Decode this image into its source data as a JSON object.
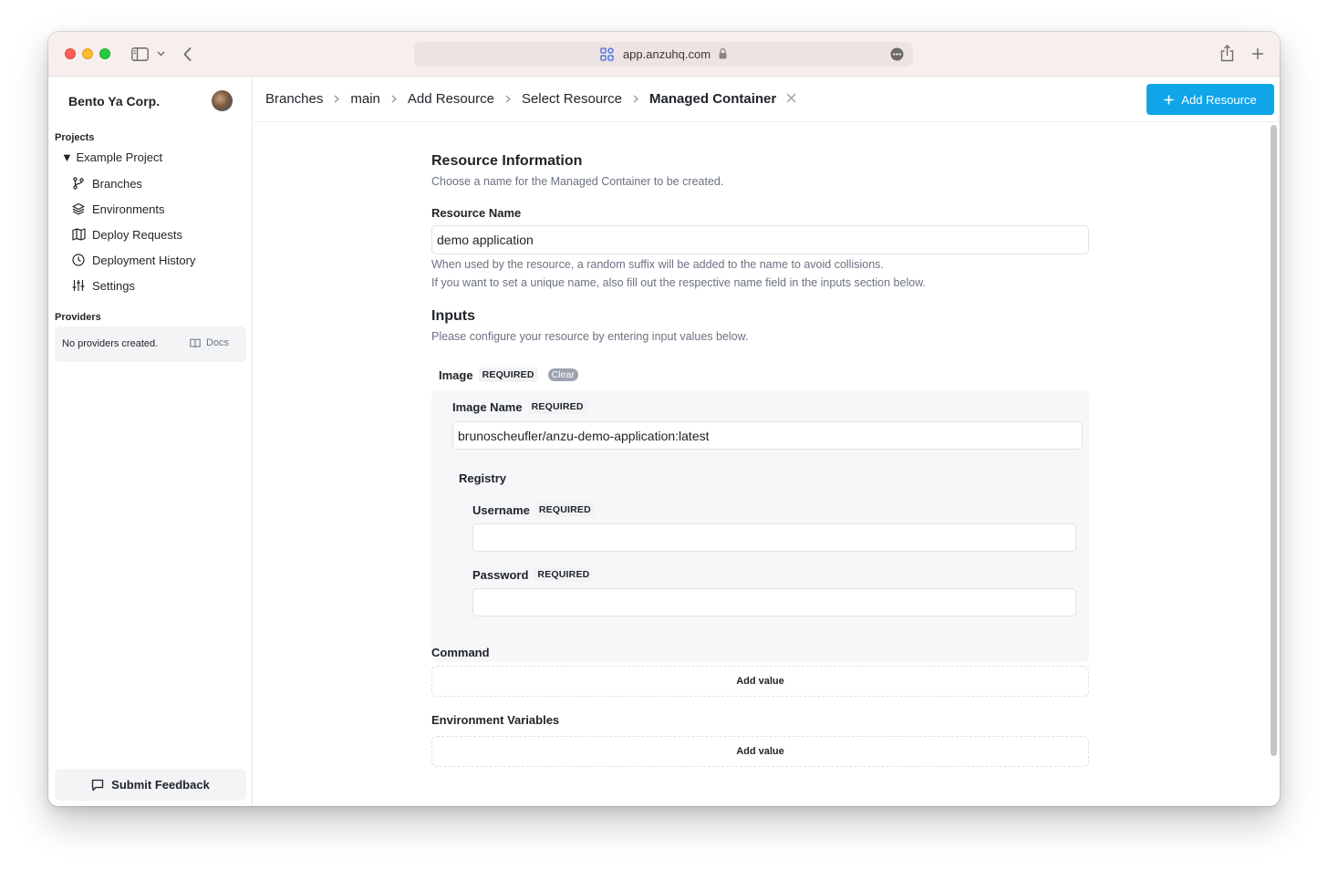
{
  "browser": {
    "url": "app.anzuhq.com"
  },
  "sidebar": {
    "org_name": "Bento Ya Corp.",
    "projects_heading": "Projects",
    "project_name": "▼ Example Project",
    "items": [
      {
        "label": "Branches",
        "icon": "branch-icon"
      },
      {
        "label": "Environments",
        "icon": "layers-icon"
      },
      {
        "label": "Deploy Requests",
        "icon": "map-icon"
      },
      {
        "label": "Deployment History",
        "icon": "clock-icon"
      },
      {
        "label": "Settings",
        "icon": "sliders-icon"
      }
    ],
    "providers_heading": "Providers",
    "providers_empty": "No providers created.",
    "docs_label": "Docs",
    "feedback_label": "Submit Feedback"
  },
  "breadcrumb": {
    "items": [
      "Branches",
      "main",
      "Add Resource",
      "Select Resource",
      "Managed Container"
    ]
  },
  "header": {
    "add_resource_label": "Add Resource"
  },
  "form": {
    "info_title": "Resource Information",
    "info_desc": "Choose a name for the Managed Container to be created.",
    "resource_name_label": "Resource Name",
    "resource_name_value": "demo application",
    "help_line1": "When used by the resource, a random suffix will be added to the name to avoid collisions.",
    "help_line2": "If you want to set a unique name, also fill out the respective name field in the inputs section below.",
    "inputs_title": "Inputs",
    "inputs_desc": "Please configure your resource by entering input values below.",
    "image_label": "Image",
    "required_label": "REQUIRED",
    "clear_label": "Clear",
    "image_name_label": "Image Name",
    "image_name_value": "brunoscheufler/anzu-demo-application:latest",
    "registry_label": "Registry",
    "username_label": "Username",
    "username_value": "",
    "password_label": "Password",
    "password_value": "",
    "command_label": "Command",
    "env_label": "Environment Variables",
    "add_value_label": "Add value"
  }
}
